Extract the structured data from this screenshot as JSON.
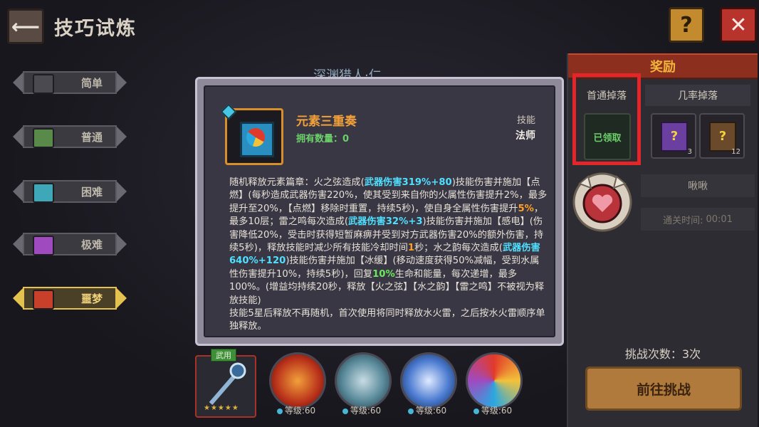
{
  "header": {
    "title": "技巧试炼",
    "help_label": "?",
    "close_label": "✕",
    "back_label": "⟵"
  },
  "difficulties": [
    {
      "label": "简单",
      "color": "#4a4a50",
      "active": false
    },
    {
      "label": "普通",
      "color": "#5a8a4a",
      "active": false
    },
    {
      "label": "困难",
      "color": "#3fa8b8",
      "active": false
    },
    {
      "label": "极难",
      "color": "#a04ac0",
      "active": false
    },
    {
      "label": "噩梦",
      "color": "#c8402a",
      "active": true
    }
  ],
  "dungeon_title": "深渊猎人·仁",
  "reward": {
    "title": "奖励",
    "first_drop_label": "首通掉落",
    "chance_drop_label": "几率掉落",
    "claimed_label": "已领取",
    "chance_items": [
      {
        "count": "3",
        "color": "purple"
      },
      {
        "count": "12",
        "color": "brown"
      }
    ],
    "boss_name": "啾啾",
    "clear_time_label": "通关时间:",
    "clear_time_value": "00:01",
    "challenge_count": "挑战次数：3次",
    "go_label": "前往挑战"
  },
  "tooltip": {
    "skill_name": "元素三重奏",
    "owned": "拥有数量：0",
    "type": "技能",
    "class": "法师",
    "description": [
      {
        "t": "随机释放元素篇章：火之弦造成("
      },
      {
        "t": "武器伤害319%+80",
        "c": "cyan"
      },
      {
        "t": ")技能伤害并施加【点燃】(每秒造成武器伤害220%，使其受到来自你的火属性伤害提升2%，最多提升至20%，【点燃】移除时重置，持续5秒)，使自身全属性伤害提升"
      },
      {
        "t": "5%",
        "c": "orange"
      },
      {
        "t": "，最多10层；雷之鸣每次造成("
      },
      {
        "t": "武器伤害32%+3",
        "c": "cyan"
      },
      {
        "t": ")技能伤害并施加【感电】(伤害降低20%，受击时获得短暂麻痹并受到对方武器伤害20%的额外伤害，持续5秒)，释放技能时减少所有技能冷却时间"
      },
      {
        "t": "1",
        "c": "orange"
      },
      {
        "t": "秒；水之韵每次造成("
      },
      {
        "t": "武器伤害640%+120",
        "c": "cyan"
      },
      {
        "t": ")技能伤害并施加【冰缓】(移动速度获得50%减幅，受到水属性伤害提升10%，持续5秒)，回复"
      },
      {
        "t": "10%",
        "c": "green"
      },
      {
        "t": "生命和能量，每次递增，最多100%。(增益均持续20秒，释放【火之弦】【水之韵】【雷之鸣】不被视为释放技能)"
      },
      {
        "t": "\n技能5星后释放不再随机，首次使用将同时释放水火雷，之后按水火雷顺序单独释放。"
      }
    ]
  },
  "weapon": {
    "tag": "武用",
    "stars": "★★★★★"
  },
  "skills": [
    {
      "level": "等级:60",
      "color": "#d2481e"
    },
    {
      "level": "等级:60",
      "color": "#4a7a8a"
    },
    {
      "level": "等级:60",
      "color": "#3f6fc0"
    },
    {
      "level": "等级:60",
      "color": "#c23a6a"
    }
  ]
}
